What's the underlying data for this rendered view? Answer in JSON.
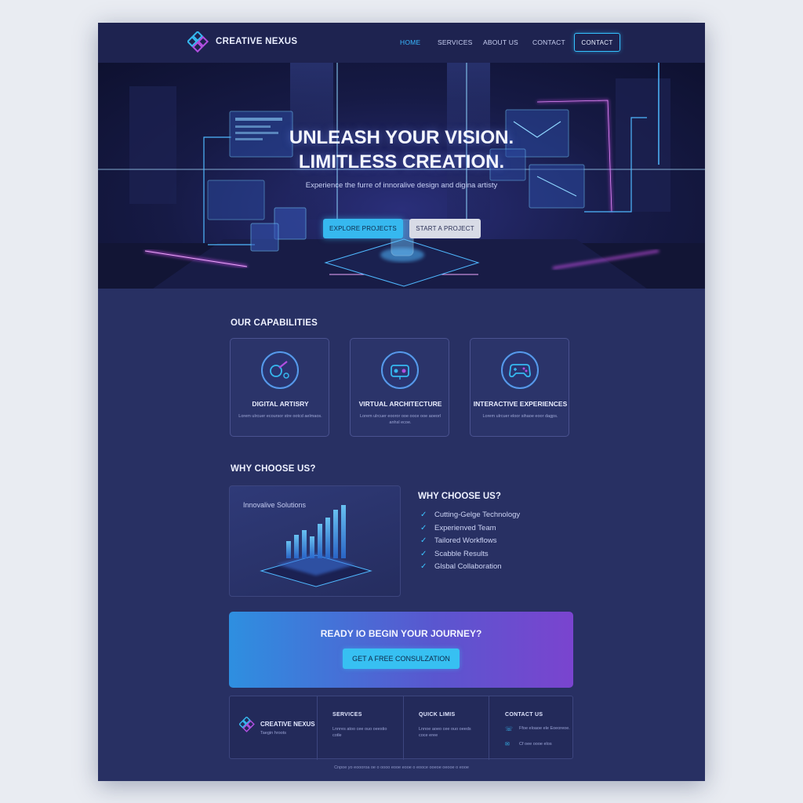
{
  "nav": {
    "brand": "CREATIVE NEXUS",
    "links": [
      "HOME",
      "SERVICES",
      "ABOUT US",
      "CONTACT"
    ],
    "cta": "CONTACT"
  },
  "hero": {
    "title_line1": "UNLEASH YOUR VISION.",
    "title_line2": "LIMITLESS CREATION.",
    "subtitle": "Experience the furre of innoralive design and digina artisty",
    "primary_button": "EXPLORE PROJECTS",
    "secondary_button": "START A PROJECT"
  },
  "capabilities": {
    "heading": "OUR CAPABILITIES",
    "cards": [
      {
        "title": "DIGITAL ARTISRY",
        "desc": "Lorem ulrcuer ecoursor stre ootcd aelmaos.",
        "icon": "palette-brush-icon"
      },
      {
        "title": "VIRTUAL ARCHITECTURE",
        "desc": "Lorem ulrcuer eooror ooe ooce ooe aoeorl anhsl ecoe.",
        "icon": "vr-headset-icon"
      },
      {
        "title": "INTERACTIVE EXPERIENCES",
        "desc": "Lorem ulrcuer eloor sihaoe eoor dagps.",
        "icon": "gamepad-icon"
      }
    ]
  },
  "why": {
    "heading": "WHY CHOOSE US?",
    "image_label": "Innovalive Solutions",
    "list_title": "WHY CHOOSE US?",
    "items": [
      "Cutting-Gelge Technology",
      "Experienved Team",
      "Tailored Workflows",
      "Scabble Results",
      "Glsbal Collaboration"
    ]
  },
  "cta": {
    "title": "READY IO BEGIN YOUR JOURNEY?",
    "button": "GET A FREE CONSULZATION"
  },
  "footer": {
    "brand": "CREATIVE NEXUS",
    "brand_sub": "Taegin hroots",
    "services_heading": "SERVICES",
    "services_text": "Lnnres atoo cee ouo oeestio cotle",
    "links_heading": "QUICK LIMIS",
    "links_text": "Lnnoe aoeo cee ouo oeeds coce eree",
    "contact_heading": "CONTACT US",
    "contact_line1": "Ffoe eloaoe ele Eoeoreoe.",
    "contact_line2": "Cf oee oooe elos",
    "copyright": "Cnpoe yo eoooroa oe o oooo eooe eooe o eooce ooeoe oeooe o eooe"
  },
  "colors": {
    "page_bg": "#283063",
    "nav_bg": "#1e2350",
    "accent_cyan": "#36b8ef",
    "accent_purple": "#7a44cf"
  }
}
